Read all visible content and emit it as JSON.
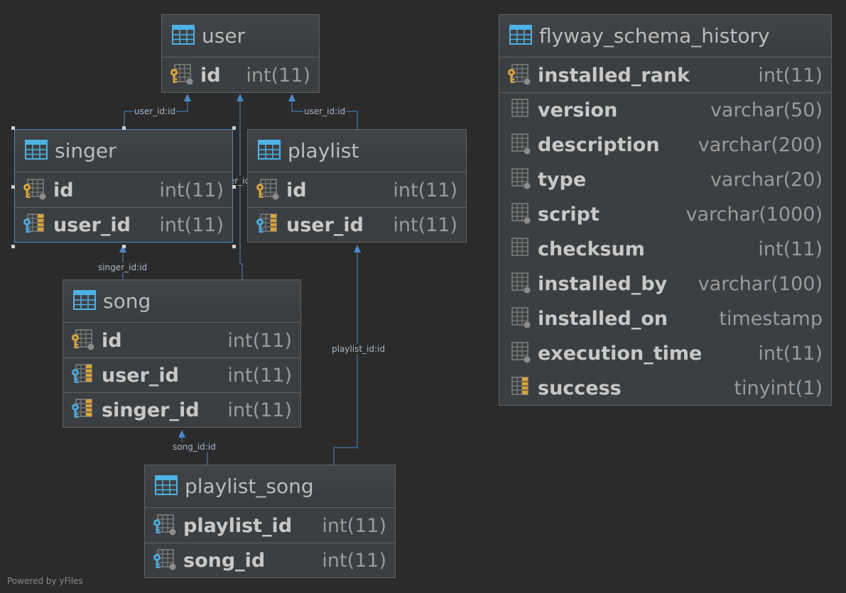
{
  "tables": {
    "user": {
      "name": "user",
      "columns": [
        {
          "name": "id",
          "type": "int(11)",
          "key": "pk"
        }
      ]
    },
    "singer": {
      "name": "singer",
      "columns": [
        {
          "name": "id",
          "type": "int(11)",
          "key": "pk"
        },
        {
          "name": "user_id",
          "type": "int(11)",
          "key": "fk"
        }
      ]
    },
    "playlist": {
      "name": "playlist",
      "columns": [
        {
          "name": "id",
          "type": "int(11)",
          "key": "pk"
        },
        {
          "name": "user_id",
          "type": "int(11)",
          "key": "fk"
        }
      ]
    },
    "song": {
      "name": "song",
      "columns": [
        {
          "name": "id",
          "type": "int(11)",
          "key": "pk"
        },
        {
          "name": "user_id",
          "type": "int(11)",
          "key": "fk"
        },
        {
          "name": "singer_id",
          "type": "int(11)",
          "key": "fk"
        }
      ]
    },
    "playlist_song": {
      "name": "playlist_song",
      "columns": [
        {
          "name": "playlist_id",
          "type": "int(11)",
          "key": "pkfk"
        },
        {
          "name": "song_id",
          "type": "int(11)",
          "key": "pkfk"
        }
      ]
    },
    "flyway": {
      "name": "flyway_schema_history",
      "columns": [
        {
          "name": "installed_rank",
          "type": "int(11)",
          "key": "pk"
        },
        {
          "name": "version",
          "type": "varchar(50)",
          "key": "plain"
        },
        {
          "name": "description",
          "type": "varchar(200)",
          "key": "col"
        },
        {
          "name": "type",
          "type": "varchar(20)",
          "key": "col"
        },
        {
          "name": "script",
          "type": "varchar(1000)",
          "key": "col"
        },
        {
          "name": "checksum",
          "type": "int(11)",
          "key": "plain"
        },
        {
          "name": "installed_by",
          "type": "varchar(100)",
          "key": "col"
        },
        {
          "name": "installed_on",
          "type": "timestamp",
          "key": "col"
        },
        {
          "name": "execution_time",
          "type": "int(11)",
          "key": "col"
        },
        {
          "name": "success",
          "type": "tinyint(1)",
          "key": "nn"
        }
      ]
    }
  },
  "relations": {
    "singer_user": "user_id:id",
    "song_user": "user_id:id",
    "playlist_user": "user_id:id",
    "song_singer": "singer_id:id",
    "playlist_song_song": "song_id:id",
    "playlist_song_playlist": "playlist_id:id"
  },
  "footer": "Powered by yFiles",
  "colors": {
    "edge": "#4a88c7",
    "pk_key": "#d7a33d",
    "fk_key": "#4aa8d8",
    "table_icon": "#4db2e6"
  }
}
